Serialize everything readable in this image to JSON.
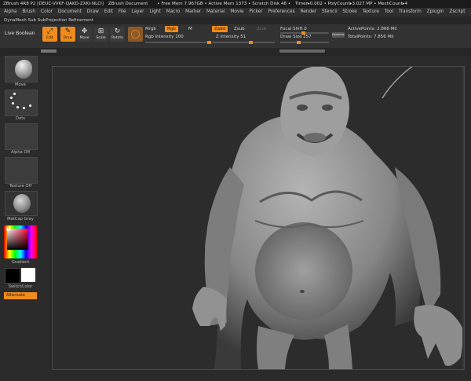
{
  "titlebar": {
    "app_title": "ZBrush 4R8 P2 [DEUC-VVKF-QAKD-ZXKI-NLCI]",
    "document": "ZBrush Document",
    "free_mem": "• Free Mem 7.967GB • Active Mem 1373 • Scratch Disk 48 •",
    "timer": "Timer▸0.002 • PolyCount▸3.027 MP • MeshCount▸4"
  },
  "menubar": {
    "items": [
      "Alpha",
      "Brush",
      "Color",
      "Document",
      "Draw",
      "Edit",
      "File",
      "Layer",
      "Light",
      "Macro",
      "Marker",
      "Material",
      "Movie",
      "Picker",
      "Preferences",
      "Render",
      "Stencil",
      "Stroke",
      "Texture",
      "Tool",
      "Transform",
      "Zplugin",
      "Zscript"
    ]
  },
  "subbar": {
    "title": "DynaMesh Sub SubProjection Refinement"
  },
  "shelf": {
    "live_boolean": "Live Boolean",
    "edit_label": "Edit",
    "draw_label": "Draw",
    "move_label": "Move",
    "scale_label": "Scale",
    "rotate_label": "Rotate",
    "mrgb": "Mrgb",
    "rgb": "Rgb",
    "m": "M",
    "zadd": "Zadd",
    "zsub": "Zsub",
    "zcut": "Zcut",
    "rgb_intensity": "Rgb Intensity 100",
    "z_intensity": "Z Intensity 51",
    "focal_shift": "Focal Shift 0",
    "draw_size": "Draw Size 257",
    "dynamic": "Dynamic",
    "active_points": "ActivePoints: 2.868 Mil",
    "total_points": "TotalPoints: 7.856 Mil"
  },
  "lefttray": {
    "move": "Move",
    "dots": "Dots",
    "alpha_off": "Alpha Off",
    "texture_off": "Texture Off",
    "matcap": "MatCap Gray",
    "gradient": "Gradient",
    "switchcolor": "SwitchColor",
    "alternate": "Alternate"
  },
  "colors": {
    "accent": "#f08b1c",
    "background": "#2a2a2a"
  }
}
